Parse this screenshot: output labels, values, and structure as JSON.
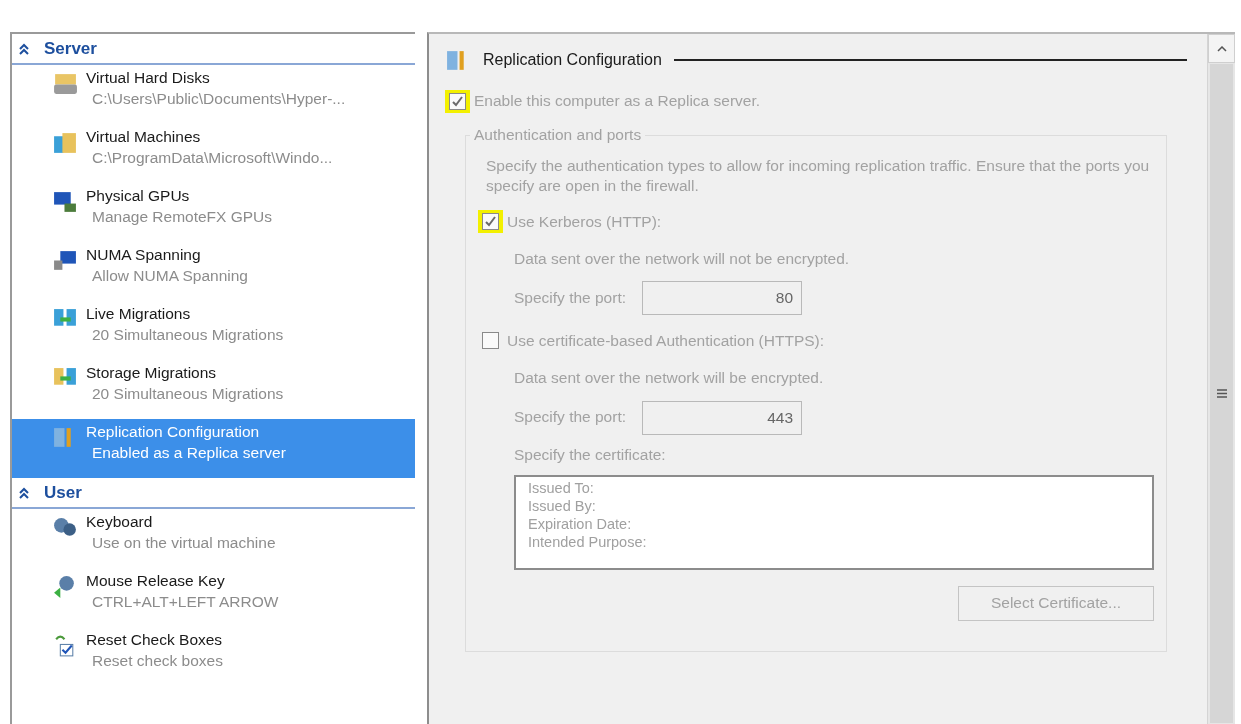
{
  "sidebar": {
    "sections": [
      {
        "title": "Server",
        "expanded": true,
        "items": [
          {
            "title": "Virtual Hard Disks",
            "subtitle": "C:\\Users\\Public\\Documents\\Hyper-...",
            "selected": false
          },
          {
            "title": "Virtual Machines",
            "subtitle": "C:\\ProgramData\\Microsoft\\Windo...",
            "selected": false
          },
          {
            "title": "Physical GPUs",
            "subtitle": "Manage RemoteFX GPUs",
            "selected": false
          },
          {
            "title": "NUMA Spanning",
            "subtitle": "Allow NUMA Spanning",
            "selected": false
          },
          {
            "title": "Live Migrations",
            "subtitle": "20 Simultaneous Migrations",
            "selected": false
          },
          {
            "title": "Storage Migrations",
            "subtitle": "20 Simultaneous Migrations",
            "selected": false
          },
          {
            "title": "Replication Configuration",
            "subtitle": "Enabled as a Replica server",
            "selected": true
          }
        ]
      },
      {
        "title": "User",
        "expanded": true,
        "items": [
          {
            "title": "Keyboard",
            "subtitle": "Use on the virtual machine",
            "selected": false
          },
          {
            "title": "Mouse Release Key",
            "subtitle": "CTRL+ALT+LEFT ARROW",
            "selected": false
          },
          {
            "title": "Reset Check Boxes",
            "subtitle": "Reset check boxes",
            "selected": false
          }
        ]
      }
    ]
  },
  "panel": {
    "title": "Replication Configuration",
    "disabled": true,
    "enable_checkbox": {
      "label": "Enable this computer as a Replica server.",
      "checked": true,
      "highlighted": true
    },
    "group": {
      "legend": "Authentication and ports",
      "description": "Specify the authentication types to allow for incoming replication traffic. Ensure that the ports you specify are open in the firewall.",
      "options": [
        {
          "label": "Use Kerberos (HTTP):",
          "checked": true,
          "highlighted": true,
          "note": "Data sent over the network will not be encrypted.",
          "port_label": "Specify the port:",
          "port": "80"
        },
        {
          "label": "Use certificate-based Authentication (HTTPS):",
          "checked": false,
          "highlighted": false,
          "note": "Data sent over the network will be encrypted.",
          "port_label": "Specify the port:",
          "port": "443",
          "certificate": {
            "label": "Specify the certificate:",
            "lines": [
              "Issued To:",
              "Issued By:",
              "Expiration Date:",
              "Intended Purpose:"
            ],
            "button": "Select Certificate..."
          }
        }
      ]
    }
  }
}
